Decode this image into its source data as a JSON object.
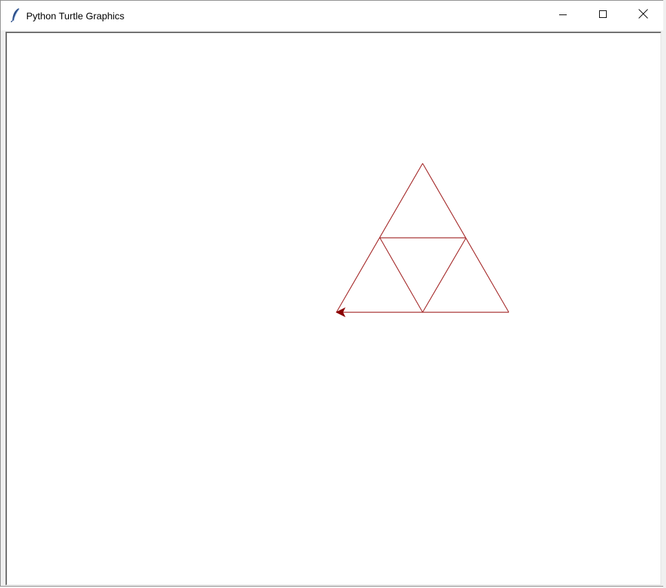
{
  "window": {
    "title": "Python Turtle Graphics",
    "app_icon": "feather-icon",
    "controls": {
      "minimize_icon": "minimize-icon",
      "maximize_icon": "maximize-icon",
      "close_icon": "close-icon"
    }
  },
  "canvas": {
    "background": "#ffffff",
    "pen_color": "#a52a2a",
    "turtle_color": "#8b0000",
    "turtle_shape": "arrow",
    "turtle_heading": "west"
  }
}
